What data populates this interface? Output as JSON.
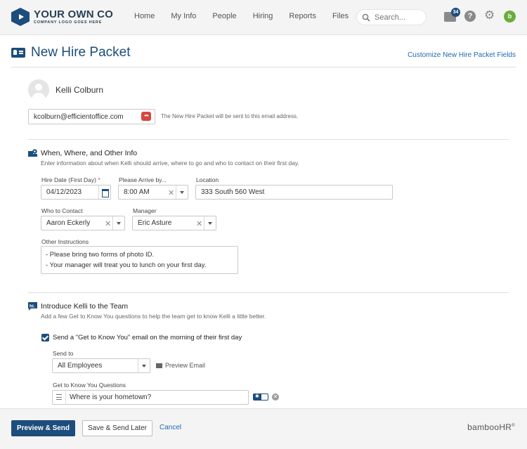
{
  "header": {
    "logo_main": "YOUR OWN CO",
    "logo_sub": "COMPANY LOGO GOES HERE",
    "nav": [
      "Home",
      "My Info",
      "People",
      "Hiring",
      "Reports",
      "Files"
    ],
    "search_placeholder": "Search...",
    "inbox_count": "34",
    "help_glyph": "?",
    "avatar_letter": "b"
  },
  "page": {
    "title": "New Hire Packet",
    "customize_link": "Customize New Hire Packet Fields"
  },
  "employee": {
    "name": "Kelli Colburn",
    "email": "kcolburn@efficientoffice.com",
    "email_note": "The New Hire Packet will be sent to this email address."
  },
  "when_where": {
    "title": "When, Where, and Other Info",
    "description": "Enter information about when Kelli should arrive, where to go and who to contact on their first day.",
    "hire_date_label": "Hire Date (First Day)",
    "hire_date": "04/12/2023",
    "arrive_label": "Please Arrive by...",
    "arrive_time": "8:00 AM",
    "location_label": "Location",
    "location": "333 South 560 West",
    "contact_label": "Who to Contact",
    "contact": "Aaron Eckerly",
    "manager_label": "Manager",
    "manager": "Eric Asture",
    "instructions_label": "Other Instructions",
    "instructions_line1": "- Please bring two forms of photo ID.",
    "instructions_line2": "- Your manager will treat you to lunch on your first day."
  },
  "introduce": {
    "title": "Introduce Kelli to the Team",
    "description": "Add a few Get to Know You questions to help the team get to know Kelli a little better.",
    "checkbox_label": "Send a \"Get to Know You\" email on the morning of their first day",
    "send_to_label": "Send to",
    "send_to": "All Employees",
    "preview_email": "Preview Email",
    "questions_label": "Get to Know You Questions",
    "question1": "Where is your hometown?"
  },
  "footer": {
    "preview_send": "Preview & Send",
    "save_send_later": "Save & Send Later",
    "cancel": "Cancel",
    "brand": "bambooHR"
  },
  "colors": {
    "brand_blue": "#1c4d7c",
    "link_blue": "#1e6bb5",
    "danger_red": "#d9453f",
    "avatar_green": "#6aad3d"
  },
  "icons": [
    "hexagon-logo-icon",
    "search-icon",
    "inbox-icon",
    "help-icon",
    "gear-icon",
    "id-card-icon",
    "more-options-icon",
    "map-pin-icon",
    "calendar-icon",
    "chevron-down-icon",
    "clear-icon",
    "hi-chat-icon",
    "checkbox-checked-icon",
    "envelope-icon",
    "drag-handle-icon",
    "required-toggle-icon",
    "remove-icon"
  ]
}
